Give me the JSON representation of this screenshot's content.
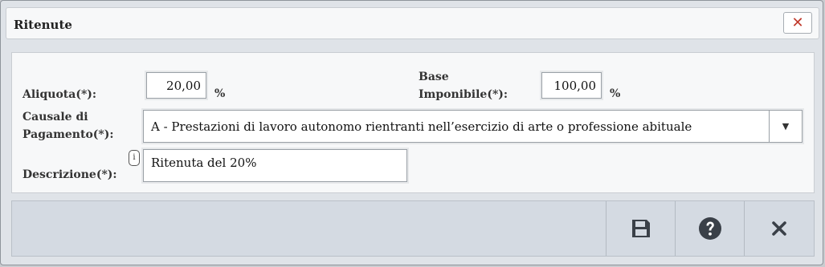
{
  "dialog": {
    "title": "Ritenute",
    "close_icon": "close-icon"
  },
  "form": {
    "aliquota": {
      "label": "Aliquota(*):",
      "value": "20,00",
      "unit": "%"
    },
    "base_imponibile": {
      "label_line1": "Base",
      "label_line2": "Imponibile(*):",
      "value": "100,00",
      "unit": "%"
    },
    "causale": {
      "label_line1": "Causale di",
      "label_line2": "Pagamento(*):",
      "selected": "A - Prestazioni di lavoro autonomo rientranti nell’esercizio di arte o professione abituale"
    },
    "descrizione": {
      "label": "Descrizione(*):",
      "value": "Ritenuta del 20%",
      "info": "i"
    }
  },
  "footer": {
    "buttons": [
      "save-icon",
      "help-icon",
      "close-icon"
    ],
    "colors": {
      "icon": "#3a4048",
      "close_red": "#c0392b"
    }
  }
}
